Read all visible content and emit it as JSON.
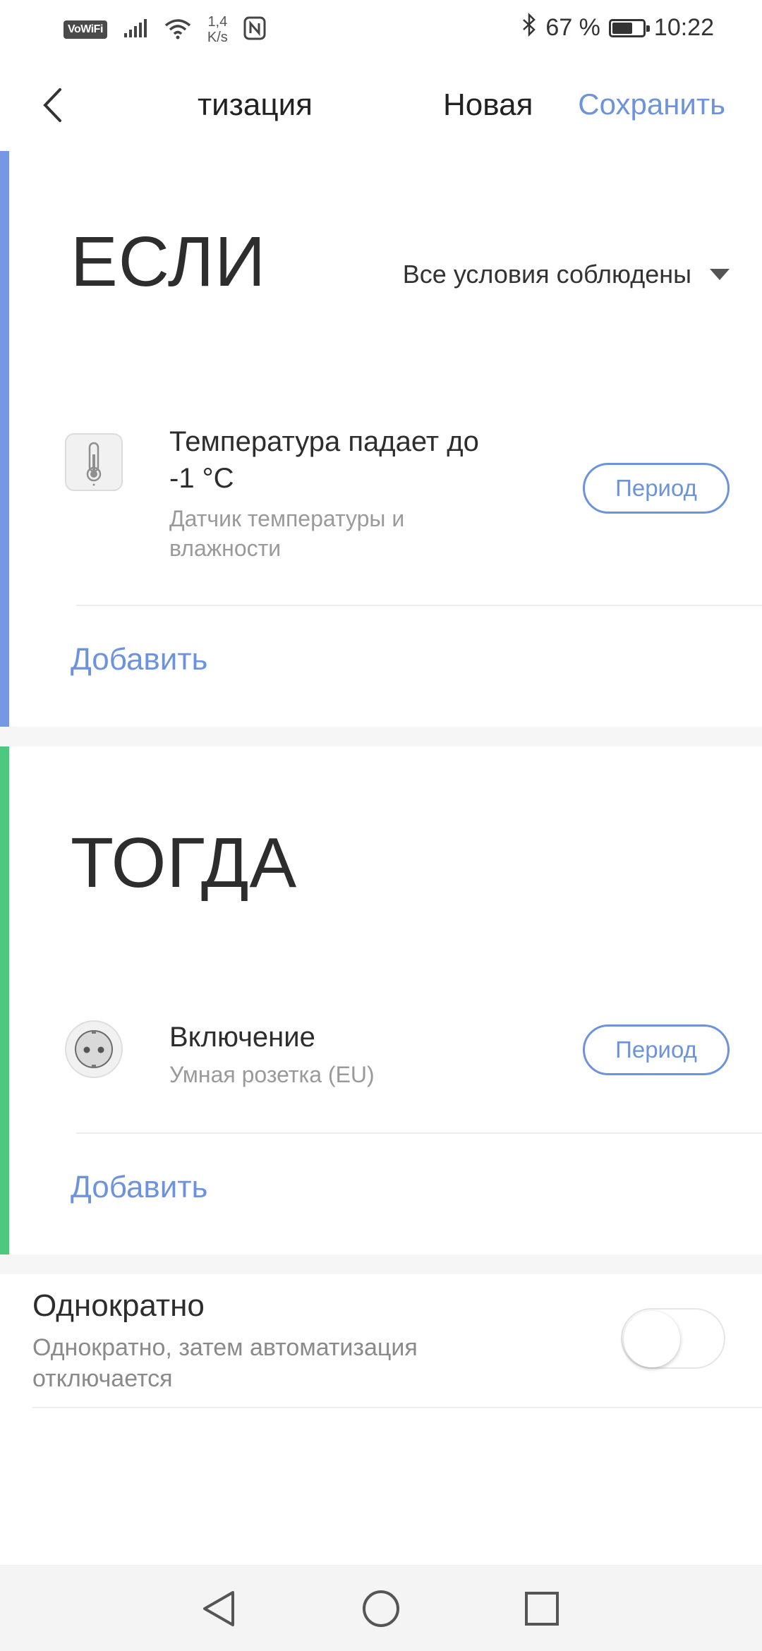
{
  "status_bar": {
    "vowifi": "VoWiFi",
    "net_speed_value": "1,4",
    "net_speed_unit": "K/s",
    "battery_percent": "67 %",
    "battery_level": 0.67,
    "time": "10:22",
    "icons": [
      "vowifi-icon",
      "signal-icon",
      "wifi-icon",
      "nfc-icon",
      "bluetooth-icon",
      "battery-icon"
    ]
  },
  "appbar": {
    "title_scrolled": "тизация",
    "title_new": "Новая",
    "save_label": "Сохранить"
  },
  "if_section": {
    "title": "ЕСЛИ",
    "condition_mode": "Все условия соблюдены",
    "accent_color": "#7597e4",
    "items": [
      {
        "title": "Температура падает до -1 °C",
        "subtitle": "Датчик температуры и влажности",
        "icon": "thermometer-icon",
        "period_label": "Период"
      }
    ],
    "add_label": "Добавить"
  },
  "then_section": {
    "title": "ТОГДА",
    "accent_color": "#4cc97f",
    "items": [
      {
        "title": "Включение",
        "subtitle": "Умная розетка (EU)",
        "icon": "socket-icon",
        "period_label": "Период"
      }
    ],
    "add_label": "Добавить"
  },
  "once": {
    "title": "Однократно",
    "description": "Однократно, затем автоматизация отключается",
    "enabled": false
  },
  "colors": {
    "accent_blue": "#6d93dd"
  },
  "nav": {
    "icons": [
      "back-triangle-icon",
      "home-circle-icon",
      "recents-square-icon"
    ]
  }
}
